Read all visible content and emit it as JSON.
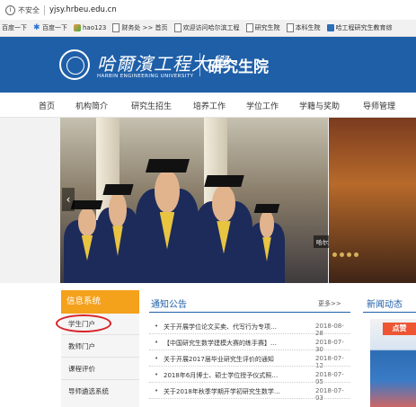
{
  "browser": {
    "info_glyph": "i",
    "security_label": "不安全",
    "url": "yjsy.hrbeu.edu.cn",
    "bookmarks": [
      {
        "label": "百度一下",
        "icon": "none"
      },
      {
        "label": "百度一下",
        "icon": "baidu-paw-icon"
      },
      {
        "label": "hao123",
        "icon": "hao123-icon"
      },
      {
        "label": "财务处 >> 首页",
        "icon": "page-icon"
      },
      {
        "label": "欢迎访问哈尔滨工程",
        "icon": "page-icon"
      },
      {
        "label": "研究生院",
        "icon": "page-icon"
      },
      {
        "label": "本科生院",
        "icon": "page-icon"
      },
      {
        "label": "哈工程研究生教育综",
        "icon": "heu-icon"
      }
    ]
  },
  "header": {
    "university_cn": "哈爾濱工程大學",
    "university_en": "HARBIN ENGINEERING UNIVERSITY",
    "school": "研究生院"
  },
  "nav": {
    "items": [
      "首页",
      "机构简介",
      "研究生招生",
      "培养工作",
      "学位工作",
      "学籍与奖助",
      "导师管理"
    ]
  },
  "banner": {
    "caption": "哈尔滨工程大学研究生院",
    "prev_arrow": "‹"
  },
  "info_system": {
    "title": "信息系统",
    "items": [
      "学生门户",
      "教师门户",
      "课程评价",
      "导师遴选系统"
    ]
  },
  "notices": {
    "title": "通知公告",
    "more": "更多>>",
    "bullet": "•",
    "items": [
      {
        "title": "关于开展学位论文买卖、代写行为专项…",
        "date": "2018-08-28"
      },
      {
        "title": "【中国研究生数学建模大赛的练手赛】…",
        "date": "2018-07-30"
      },
      {
        "title": "关于开展2017届毕业研究生评价的通知",
        "date": "2018-07-12"
      },
      {
        "title": "2018年6月博士、硕士学位授予仪式照…",
        "date": "2018-07-05"
      },
      {
        "title": "关于2018年秋季学期开学初研究生数学…",
        "date": "2018-07-03"
      }
    ]
  },
  "news": {
    "title": "新闻动态",
    "image_text": "点赞"
  },
  "colors": {
    "brand_blue": "#1f5fa8",
    "accent_orange": "#f4a11c",
    "highlight_red": "#d9232b"
  }
}
